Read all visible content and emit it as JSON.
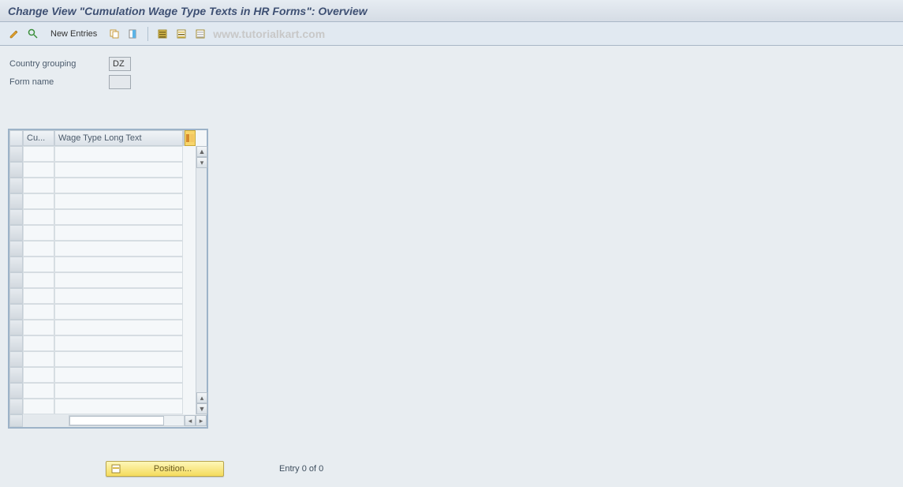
{
  "title": "Change View \"Cumulation Wage Type Texts in HR Forms\": Overview",
  "toolbar": {
    "new_entries_label": "New Entries",
    "icons": {
      "toggle": "toggle-display-change-icon",
      "other": "other-entry-icon",
      "copy": "copy-as-icon",
      "delete": "delete-icon",
      "select_all": "select-all-icon",
      "select_block": "select-block-icon",
      "deselect_all": "deselect-all-icon"
    }
  },
  "watermark": "www.tutorialkart.com",
  "form": {
    "country_grouping_label": "Country grouping",
    "country_grouping_value": "DZ",
    "form_name_label": "Form name",
    "form_name_value": ""
  },
  "grid": {
    "col1_header": "Cu...",
    "col2_header": "Wage Type Long Text",
    "row_count": 17
  },
  "footer": {
    "position_label": "Position...",
    "entry_text": "Entry 0 of 0"
  }
}
